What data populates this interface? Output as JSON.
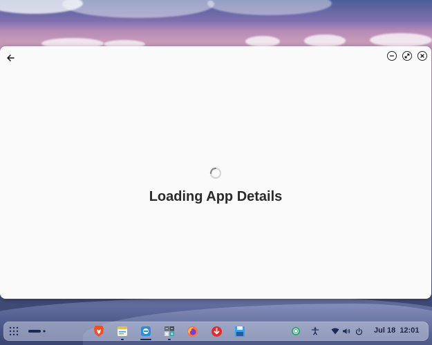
{
  "window": {
    "loading_title": "Loading App Details"
  },
  "taskbar": {
    "date": "Jul 18",
    "time": "12:01",
    "apps": [
      {
        "icon": "brave-browser-icon",
        "color": "#f04e23"
      },
      {
        "icon": "notes-icon",
        "color": "#e7c04a"
      },
      {
        "icon": "software-center-icon",
        "color": "#2a8fe0"
      },
      {
        "icon": "calculator-icon",
        "color": "#5a6a70"
      },
      {
        "icon": "firefox-icon",
        "color": "#ff7139"
      },
      {
        "icon": "downloader-icon",
        "color": "#e42b2b"
      },
      {
        "icon": "disk-icon",
        "color": "#3aa0e8"
      }
    ]
  },
  "colors": {
    "window_bg": "#fafafa",
    "title_text": "#2a2a2a",
    "taskbar_text": "#1b2340"
  }
}
